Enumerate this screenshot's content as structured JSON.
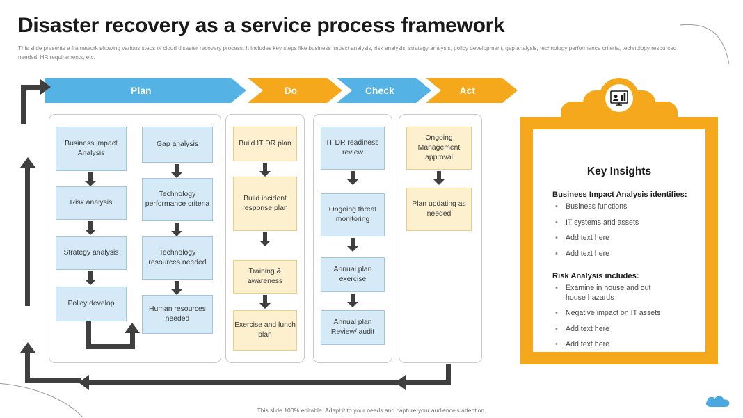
{
  "slide": {
    "title": "Disaster recovery as a service process framework",
    "subtitle": "This slide presents a framework showing various steps of cloud disaster recovery process. It includes key steps like business impact analysis, risk analysis, strategy analysis, policy development, gap analysis, technology performance criteria, technology resourced needed, HR requirements, etc.",
    "footer": "This slide 100% editable. Adapt it to your needs and capture your audience's attention."
  },
  "colors": {
    "blue": "#54b3e4",
    "orange": "#f5a81c",
    "box_blue_fill": "#d5eaf6",
    "box_blue_border": "#9ec6dc",
    "box_yellow_fill": "#fcf0cf",
    "box_yellow_border": "#e8ce87",
    "arrow": "#3f3f3f",
    "title": "#1a1a1a",
    "subtitle": "#808080"
  },
  "banner": {
    "phases": [
      {
        "label": "Plan",
        "color": "#54b3e4"
      },
      {
        "label": "Do",
        "color": "#f5a81c"
      },
      {
        "label": "Check",
        "color": "#54b3e4"
      },
      {
        "label": "Act",
        "color": "#f5a81c"
      }
    ]
  },
  "columns": [
    {
      "phase": "Plan",
      "subcolumns": [
        {
          "style": "blue",
          "steps": [
            "Business impact Analysis",
            "Risk analysis",
            "Strategy analysis",
            "Policy develop"
          ]
        },
        {
          "style": "blue",
          "steps": [
            "Gap analysis",
            "Technology performance criteria",
            "Technology resources needed",
            "Human resources needed"
          ]
        }
      ]
    },
    {
      "phase": "Do",
      "subcolumns": [
        {
          "style": "yellow",
          "steps": [
            "Build IT DR plan",
            "Build incident response plan",
            "Training & awareness",
            "Exercise and lunch plan"
          ]
        }
      ]
    },
    {
      "phase": "Check",
      "subcolumns": [
        {
          "style": "blue",
          "steps": [
            "IT DR readiness review",
            "Ongoing threat monitoring",
            "Annual plan exercise",
            "Annual plan Review/ audit"
          ]
        }
      ]
    },
    {
      "phase": "Act",
      "subcolumns": [
        {
          "style": "yellow",
          "steps": [
            "Ongoing Management approval",
            "Plan updating as needed"
          ]
        }
      ]
    }
  ],
  "boxes": {
    "c1_1": "Business impact Analysis",
    "c1_2": "Risk analysis",
    "c1_3": "Strategy analysis",
    "c1_4": "Policy develop",
    "c2_1": "Gap analysis",
    "c2_2": "Technology performance criteria",
    "c2_3": "Technology resources needed",
    "c2_4": "Human resources needed",
    "c3_1": "Build IT DR plan",
    "c3_2": "Build incident response plan",
    "c3_3": "Training & awareness",
    "c3_4": "Exercise and lunch plan",
    "c4_1": "IT DR readiness review",
    "c4_2": "Ongoing threat monitoring",
    "c4_3": "Annual plan exercise",
    "c4_4": "Annual plan Review/ audit",
    "c5_1": "Ongoing Management approval",
    "c5_2": "Plan updating as needed"
  },
  "key_insights": {
    "title": "Key Insights",
    "sections": [
      {
        "heading": "Business Impact Analysis identifies:",
        "items": [
          "Business functions",
          "IT  systems and assets",
          "Add text here",
          "Add text here"
        ]
      },
      {
        "heading": "Risk Analysis includes:",
        "items": [
          "Examine in house and out house hazards",
          "Negative impact on IT assets",
          "Add text here",
          "Add text here"
        ]
      }
    ],
    "icon": "presentation-chart-icon"
  }
}
